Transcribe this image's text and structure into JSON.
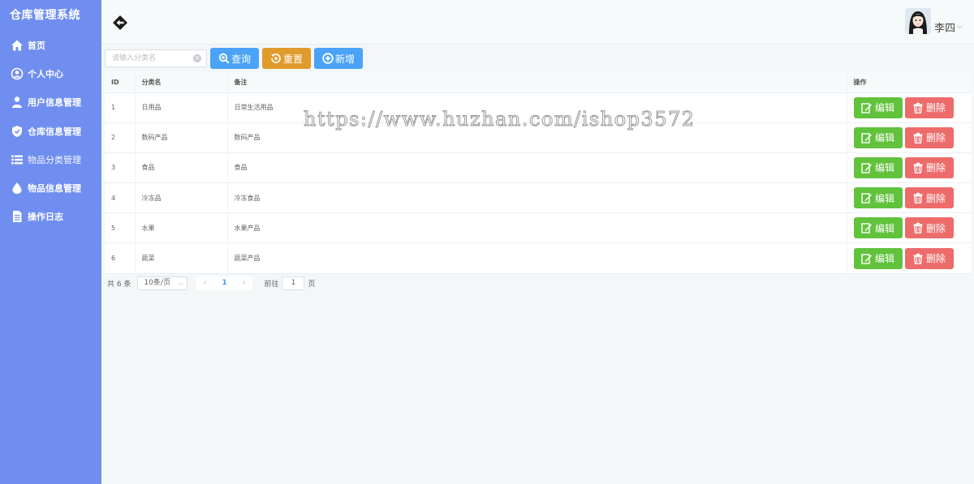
{
  "app": {
    "title": "仓库管理系统"
  },
  "sidebar": {
    "items": [
      {
        "label": "首页",
        "icon": "home-icon"
      },
      {
        "label": "个人中心",
        "icon": "user-circle-icon"
      },
      {
        "label": "用户信息管理",
        "icon": "user-icon"
      },
      {
        "label": "仓库信息管理",
        "icon": "shield-icon"
      },
      {
        "label": "物品分类管理",
        "icon": "list-icon"
      },
      {
        "label": "物品信息管理",
        "icon": "drop-icon"
      },
      {
        "label": "操作日志",
        "icon": "document-icon"
      }
    ]
  },
  "header": {
    "username": "李四",
    "caret": "⌵"
  },
  "toolbar": {
    "search_placeholder": "请输入分类名",
    "query_label": "查询",
    "reset_label": "重置",
    "add_label": "新增"
  },
  "table": {
    "columns": [
      "ID",
      "分类名",
      "备注",
      "操作"
    ],
    "rows": [
      {
        "id": "1",
        "name": "日用品",
        "note": "日常生活用品"
      },
      {
        "id": "2",
        "name": "数码产品",
        "note": "数码产品"
      },
      {
        "id": "3",
        "name": "食品",
        "note": "食品"
      },
      {
        "id": "4",
        "name": "冷冻品",
        "note": "冷冻食品"
      },
      {
        "id": "5",
        "name": "水果",
        "note": "水果产品"
      },
      {
        "id": "6",
        "name": "蔬菜",
        "note": "蔬菜产品"
      }
    ],
    "edit_label": "编辑",
    "delete_label": "删除"
  },
  "pagination": {
    "total": "共 6 条",
    "page_size": "10条/页",
    "prev": "‹",
    "current": "1",
    "next": "›",
    "jump_label": "前往",
    "jump_value": "1",
    "jump_suffix": "页"
  },
  "watermark": "https://www.huzhan.com/ishop3572",
  "colors": {
    "sidebar": "#6f8ef0",
    "primary": "#4aa3f7",
    "warning": "#e09b2d",
    "success": "#61c23c",
    "danger": "#ee6b6b"
  }
}
